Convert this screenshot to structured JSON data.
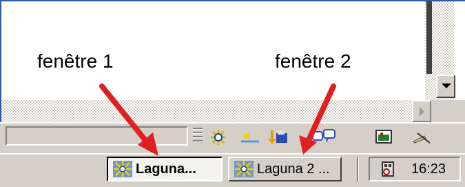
{
  "labels": {
    "window1": "fenêtre 1",
    "window2": "fenêtre 2"
  },
  "taskbar": {
    "buttons": [
      {
        "label": "Laguna...",
        "state": "pressed"
      },
      {
        "label": "Laguna 2 ...",
        "state": "normal"
      }
    ],
    "clock": "16:23"
  },
  "icons": {
    "app_icon": "laguna-app-icon",
    "tray": [
      "network-icon",
      "sun-icon",
      "printer-arrow-icon",
      "chat-icon",
      "monitor-icon",
      "pen-icon"
    ],
    "speaker_icon": "volume-icon"
  },
  "colors": {
    "arrow": "#e02020",
    "face": "#d4d0c8",
    "frame": "#2a5aa8"
  }
}
